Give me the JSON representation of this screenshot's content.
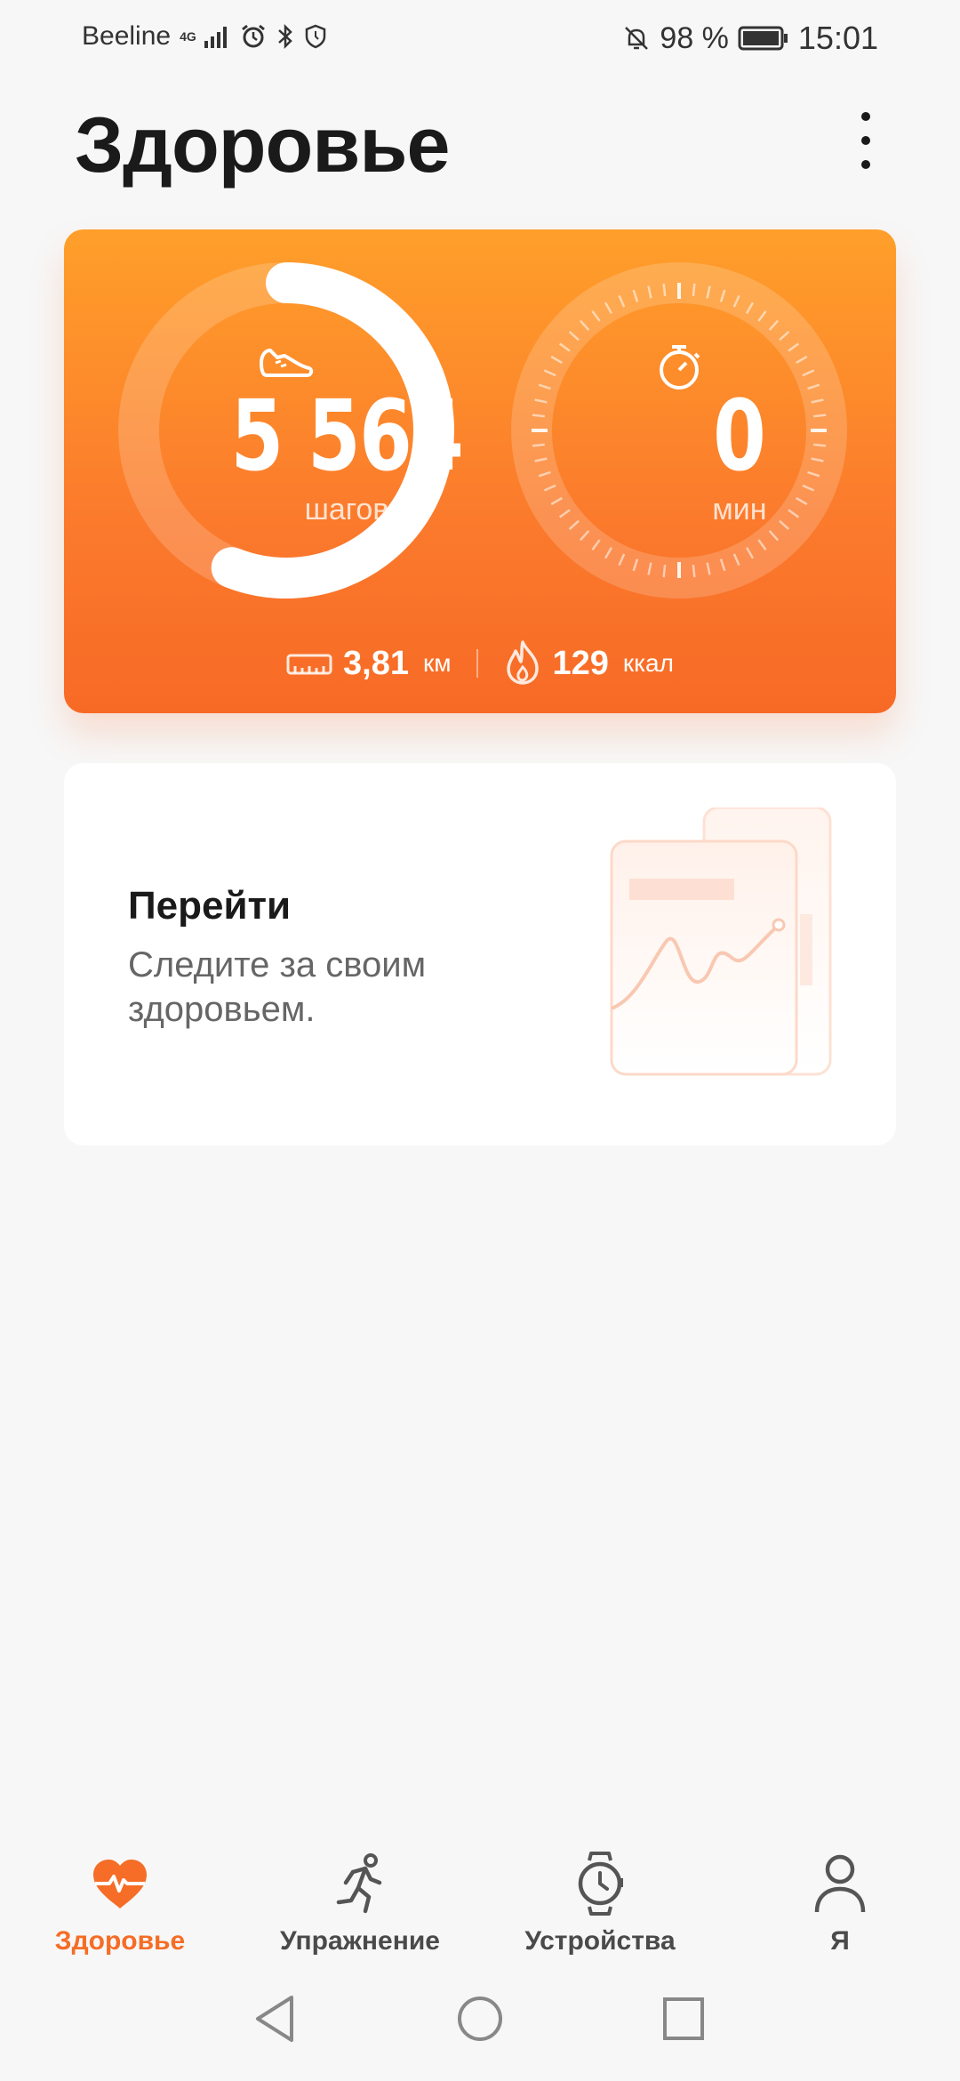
{
  "status_bar": {
    "carrier": "Beeline",
    "network": "4G",
    "battery": "98 %",
    "time": "15:01",
    "icons": [
      "signal-icon",
      "alarm-icon",
      "bluetooth-icon",
      "shield-icon",
      "bell-off-icon",
      "battery-icon"
    ]
  },
  "header": {
    "title": "Здоровье",
    "menu_icon": "more-vertical-icon"
  },
  "activity": {
    "steps_value": "5 564",
    "steps_unit": "шагов",
    "steps_progress": 0.56,
    "minutes_value": "0",
    "minutes_unit": "мин",
    "distance_value": "3,81",
    "distance_unit": "км",
    "calories_value": "129",
    "calories_unit": "ккал",
    "colors": {
      "card_top": "#ff9f2a",
      "card_bottom": "#f76a26"
    }
  },
  "promo": {
    "title": "Перейти",
    "text": "Следите за своим здоровьем."
  },
  "bottom_nav": {
    "items": [
      {
        "label": "Здоровье",
        "icon": "heart-pulse-icon",
        "active": true
      },
      {
        "label": "Упражнение",
        "icon": "runner-icon",
        "active": false
      },
      {
        "label": "Устройства",
        "icon": "watch-icon",
        "active": false
      },
      {
        "label": "Я",
        "icon": "person-icon",
        "active": false
      }
    ],
    "accent": "#f56d26"
  },
  "system_nav": {
    "buttons": [
      "back-icon",
      "home-icon",
      "recents-icon"
    ]
  }
}
